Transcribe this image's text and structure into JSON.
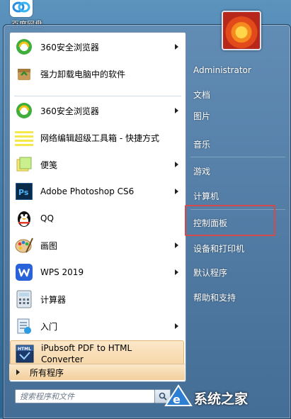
{
  "desktop": {
    "icon_label": "百度网盘"
  },
  "start_menu": {
    "programs": [
      {
        "label": "360安全浏览器",
        "icon": "360-browser-icon",
        "submenu": true
      },
      {
        "label": "强力卸载电脑中的软件",
        "icon": "uninstall-icon",
        "submenu": false
      },
      {
        "label": "360安全浏览器",
        "icon": "360-browser-icon",
        "submenu": true
      },
      {
        "label": "网络编辑超级工具箱 - 快捷方式",
        "icon": "notepad-icon",
        "submenu": false
      },
      {
        "label": "便笺",
        "icon": "sticky-notes-icon",
        "submenu": true
      },
      {
        "label": "Adobe Photoshop CS6",
        "icon": "photoshop-icon",
        "submenu": true
      },
      {
        "label": "QQ",
        "icon": "qq-penguin-icon",
        "submenu": false
      },
      {
        "label": "画图",
        "icon": "paint-icon",
        "submenu": true
      },
      {
        "label": "WPS 2019",
        "icon": "wps-icon",
        "submenu": true
      },
      {
        "label": "计算器",
        "icon": "calculator-icon",
        "submenu": false
      },
      {
        "label": "入门",
        "icon": "getting-started-icon",
        "submenu": true
      },
      {
        "label": "iPubsoft PDF to HTML Converter",
        "label_line1": "iPubsoft PDF to HTML",
        "label_line2": "Converter",
        "icon": "html-converter-icon",
        "submenu": false
      }
    ],
    "all_programs": "所有程序",
    "search_placeholder": "搜索程序和文件",
    "right_items": [
      {
        "label": "Administrator"
      },
      {
        "label": "文档"
      },
      {
        "label": "图片"
      },
      {
        "label": "音乐"
      },
      {
        "label": "游戏"
      },
      {
        "label": "计算机"
      },
      {
        "label": "控制面板"
      },
      {
        "label": "设备和打印机"
      },
      {
        "label": "默认程序"
      },
      {
        "label": "帮助和支持"
      }
    ]
  },
  "watermark": {
    "text": "系统之家"
  },
  "colors": {
    "highlight_box": "#d44a4a",
    "hover_fill": "#f6d6a6"
  }
}
